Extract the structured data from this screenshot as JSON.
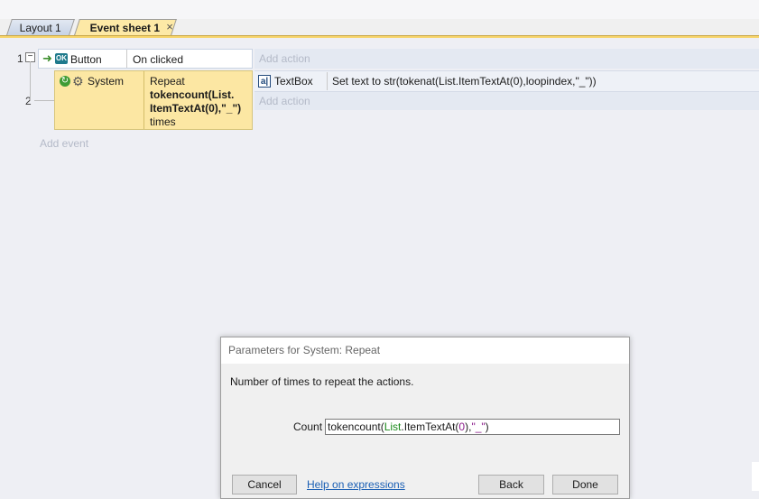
{
  "tabs": [
    {
      "label": "Layout 1"
    },
    {
      "label": "Event sheet 1",
      "close": "×"
    }
  ],
  "event_sheet": {
    "event_numbers": [
      "1",
      "2"
    ],
    "expander": "−",
    "event1": {
      "condition": {
        "object": "Button",
        "icon_text": "OK",
        "text": "On clicked"
      },
      "add_action": "Add action"
    },
    "event2": {
      "condition": {
        "object": "System",
        "text_lines": [
          "Repeat",
          "tokencount(List.",
          "ItemTextAt(0),\"_\")",
          "times"
        ]
      },
      "action": {
        "object": "TextBox",
        "text": "Set text to str(tokenat(List.ItemTextAt(0),loopindex,\"_\"))"
      },
      "add_action": "Add action"
    },
    "add_event": "Add event"
  },
  "dialog": {
    "title": "Parameters for System: Repeat",
    "description": "Number of times to repeat the actions.",
    "count_label": "Count",
    "count_value_parts": [
      "tokencount(",
      "List",
      ".ItemTextAt(",
      "0",
      "),",
      "\"_\"",
      ")"
    ],
    "cancel_label": "Cancel",
    "help_link": "Help on expressions",
    "back_label": "Back",
    "done_label": "Done"
  }
}
